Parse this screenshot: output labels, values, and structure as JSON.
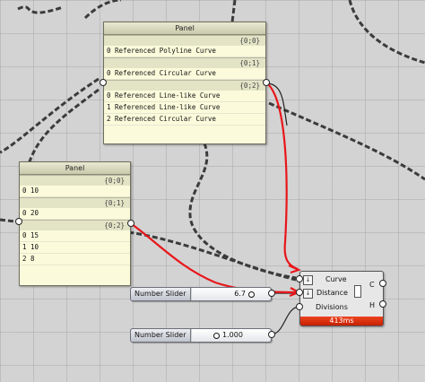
{
  "panel1": {
    "title": "Panel",
    "branches": [
      {
        "path": "{0;0}",
        "items": [
          "0 Referenced Polyline Curve"
        ]
      },
      {
        "path": "{0;1}",
        "items": [
          "0 Referenced Circular Curve"
        ]
      },
      {
        "path": "{0;2}",
        "items": [
          "0 Referenced Line-like Curve",
          "1 Referenced Line-like Curve",
          "2 Referenced Circular Curve"
        ]
      }
    ]
  },
  "panel2": {
    "title": "Panel",
    "branches": [
      {
        "path": "{0;0}",
        "items": [
          "0 10"
        ]
      },
      {
        "path": "{0;1}",
        "items": [
          "0 20"
        ]
      },
      {
        "path": "{0;2}",
        "items": [
          "0 15",
          "1 10",
          "2 8"
        ]
      }
    ]
  },
  "slider1": {
    "label": "Number Slider",
    "value": "6.7",
    "fraction": 0.85
  },
  "slider2": {
    "label": "Number Slider",
    "value": "1.000",
    "fraction": 0.55
  },
  "component": {
    "inputs": [
      "Curve",
      "Distance",
      "Divisions"
    ],
    "outputs": [
      "C",
      "H"
    ],
    "status": "413ms",
    "status_color": "#e03a10"
  },
  "annotation_color": "#e8161a"
}
